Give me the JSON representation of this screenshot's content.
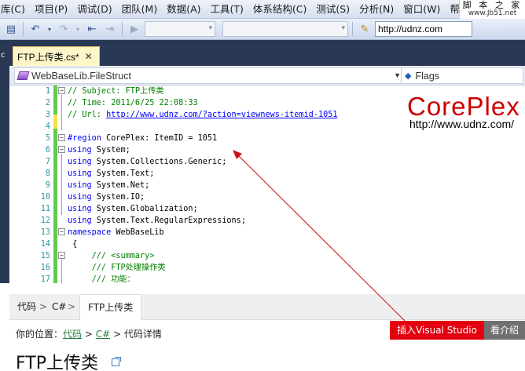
{
  "menu": [
    "库(C)",
    "项目(P)",
    "调试(D)",
    "团队(M)",
    "数据(A)",
    "工具(T)",
    "体系结构(C)",
    "测试(S)",
    "分析(N)",
    "窗口(W)",
    "帮助("
  ],
  "watermark": {
    "title": "脚 本 之 家",
    "url": "www.Jb51.net"
  },
  "toolbar": {
    "url_value": "http://udnz.com"
  },
  "left_strip": "c",
  "tab": {
    "label": "FTP上传类.cs*",
    "close": "✕"
  },
  "nav": {
    "left": "WebBaseLib.FileStruct",
    "right": "Flags"
  },
  "code_lines": [
    {
      "n": "1",
      "fold": "−",
      "html": "<span class='cm'>// Subject: FTP上传类</span>"
    },
    {
      "n": "2",
      "fold": "",
      "html": "<span class='cm'>// Time: 2011/6/25 22:08:33</span>"
    },
    {
      "n": "3",
      "fold": "",
      "html": "<span class='cm'>// Url: </span><span class='lk'>http://www.udnz.com/?action=viewnews-itemid-1051</span>"
    },
    {
      "n": "4",
      "fold": "",
      "html": ""
    },
    {
      "n": "5",
      "fold": "−",
      "html": "<span class='kw'>#region</span><span class='tx'> CorePlex: ItemID = 1051</span>"
    },
    {
      "n": "6",
      "fold": "−",
      "html": "<span class='kw'>using</span><span class='tx'> System;</span>"
    },
    {
      "n": "7",
      "fold": "",
      "html": "<span class='kw'>using</span><span class='tx'> System.Collections.Generic;</span>"
    },
    {
      "n": "8",
      "fold": "",
      "html": "<span class='kw'>using</span><span class='tx'> System.Text;</span>"
    },
    {
      "n": "9",
      "fold": "",
      "html": "<span class='kw'>using</span><span class='tx'> System.Net;</span>"
    },
    {
      "n": "10",
      "fold": "",
      "html": "<span class='kw'>using</span><span class='tx'> System.IO;</span>"
    },
    {
      "n": "11",
      "fold": "",
      "html": "<span class='kw'>using</span><span class='tx'> System.Globalization;</span>"
    },
    {
      "n": "12",
      "fold": "",
      "html": "<span class='kw'>using</span><span class='tx'> System.Text.RegularExpressions;</span>"
    },
    {
      "n": "13",
      "fold": "−",
      "html": "<span class='kw'>namespace</span><span class='tx'> WebBaseLib</span>"
    },
    {
      "n": "14",
      "fold": "",
      "html": "<span class='tx'> {</span>"
    },
    {
      "n": "15",
      "fold": "−",
      "html": "<span class='cm'>     /// &lt;summary&gt;</span>"
    },
    {
      "n": "16",
      "fold": "",
      "html": "<span class='cm'>     /// FTP处理操作类</span>"
    },
    {
      "n": "17",
      "fold": "",
      "html": "<span class='cm'>     /// 功能：</span>"
    }
  ],
  "logo": {
    "text": "CorePlex",
    "url": "http://www.udnz.com/"
  },
  "browser": {
    "tab1": "代码",
    "sep1": ">",
    "tab2": "C#",
    "sep2": ">",
    "tab_active": "FTP上传类",
    "location_prefix": "你的位置：",
    "loc_link1": "代码",
    "loc_sep1": " > ",
    "loc_link2": "C#",
    "loc_tail": " > 代码详情",
    "insert_button": "插入Visual Studio",
    "view_button": "看介绍",
    "title": "FTP上传类"
  },
  "colors": {
    "accent_red": "#e3000f",
    "logo_red": "#cc0000",
    "margin_green": "#5fcb4f",
    "vs_dark": "#293955"
  }
}
